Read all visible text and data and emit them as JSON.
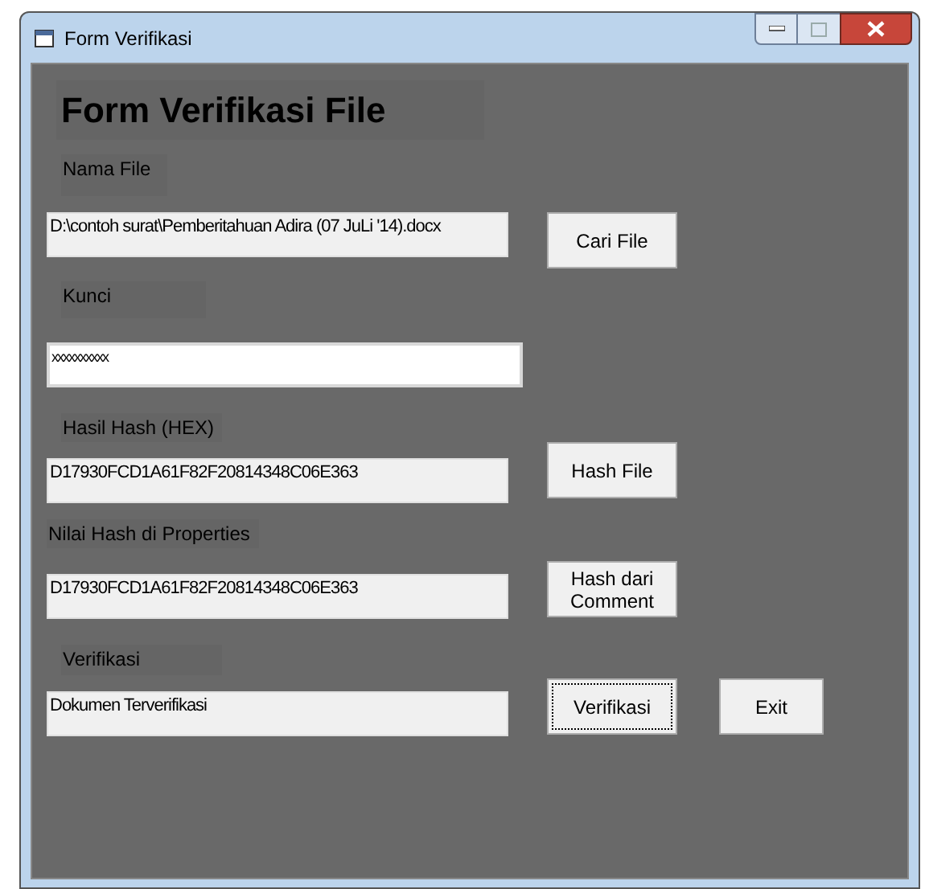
{
  "window": {
    "title": "Form Verifikasi"
  },
  "heading": "Form Verifikasi File",
  "rows": [
    {
      "label": "Nama File",
      "value": "D:\\contoh surat\\Pemberitahuan Adira (07 JuLi '14).docx",
      "readonly": true,
      "buttons": [
        {
          "label": "Cari File",
          "focused": false
        }
      ]
    },
    {
      "label": "Kunci",
      "value": "xxxxxxxxxx",
      "readonly": false,
      "buttons": []
    },
    {
      "label": "Hasil Hash (HEX)",
      "value": "D17930FCD1A61F82F20814348C06E363",
      "readonly": true,
      "buttons": [
        {
          "label": "Hash File",
          "focused": false
        }
      ]
    },
    {
      "label": "Nilai Hash di Properties",
      "value": "D17930FCD1A61F82F20814348C06E363",
      "readonly": true,
      "buttons": [
        {
          "label": "Hash dari Comment",
          "focused": false
        }
      ]
    },
    {
      "label": "Verifikasi",
      "value": "Dokumen Terverifikasi",
      "readonly": true,
      "buttons": [
        {
          "label": "Verifikasi",
          "focused": true
        },
        {
          "label": "Exit",
          "focused": false
        }
      ]
    }
  ]
}
